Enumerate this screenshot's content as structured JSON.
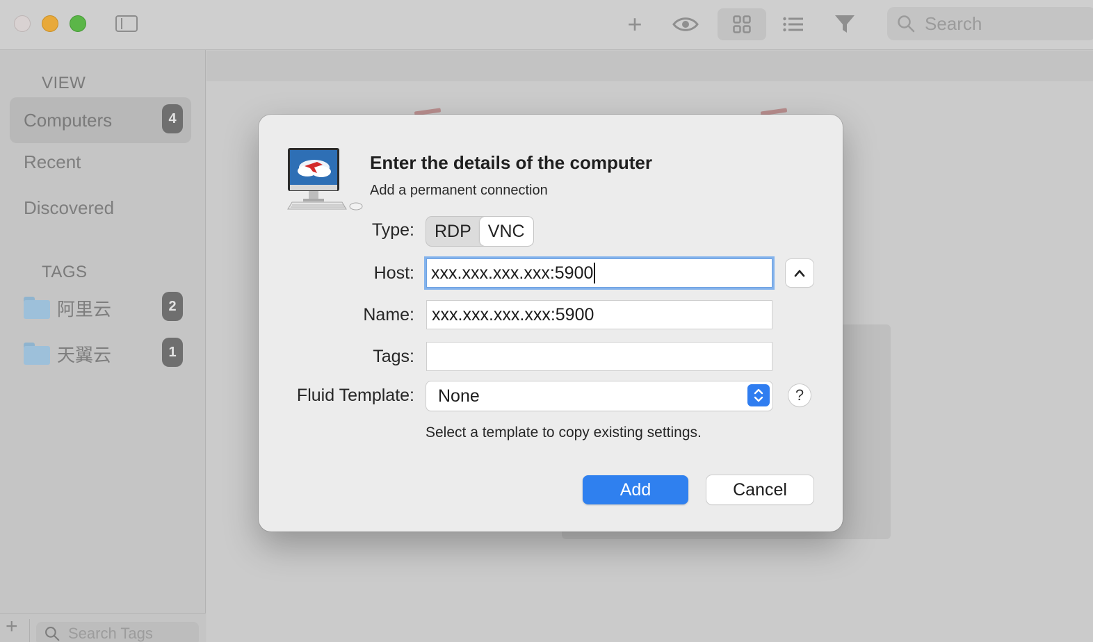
{
  "toolbar": {
    "plus_glyph": "+",
    "search_placeholder": "Search"
  },
  "sidebar": {
    "view_title": "VIEW",
    "items": [
      {
        "label": "Computers",
        "badge": "4"
      },
      {
        "label": "Recent"
      },
      {
        "label": "Discovered"
      }
    ],
    "tags_title": "TAGS",
    "tags": [
      {
        "label": "阿里云",
        "badge": "2"
      },
      {
        "label": "天翼云",
        "badge": "1"
      }
    ],
    "add_glyph": "+",
    "search_tags_placeholder": "Search Tags"
  },
  "dialog": {
    "title": "Enter the details of the computer",
    "subtitle": "Add a permanent connection",
    "type_label": "Type:",
    "type_options": [
      "RDP",
      "VNC"
    ],
    "type_selected": "VNC",
    "host_label": "Host:",
    "host_value": "xxx.xxx.xxx.xxx:5900",
    "name_label": "Name:",
    "name_value": "xxx.xxx.xxx.xxx:5900",
    "tags_label": "Tags:",
    "tags_value": "",
    "template_label": "Fluid Template:",
    "template_value": "None",
    "help_glyph": "?",
    "template_hint": "Select a template to copy existing settings.",
    "add_label": "Add",
    "cancel_label": "Cancel"
  },
  "colors": {
    "accent": "#2f80ef",
    "focus_ring": "#84b3ec",
    "badge_bg": "#6f6f6f"
  }
}
